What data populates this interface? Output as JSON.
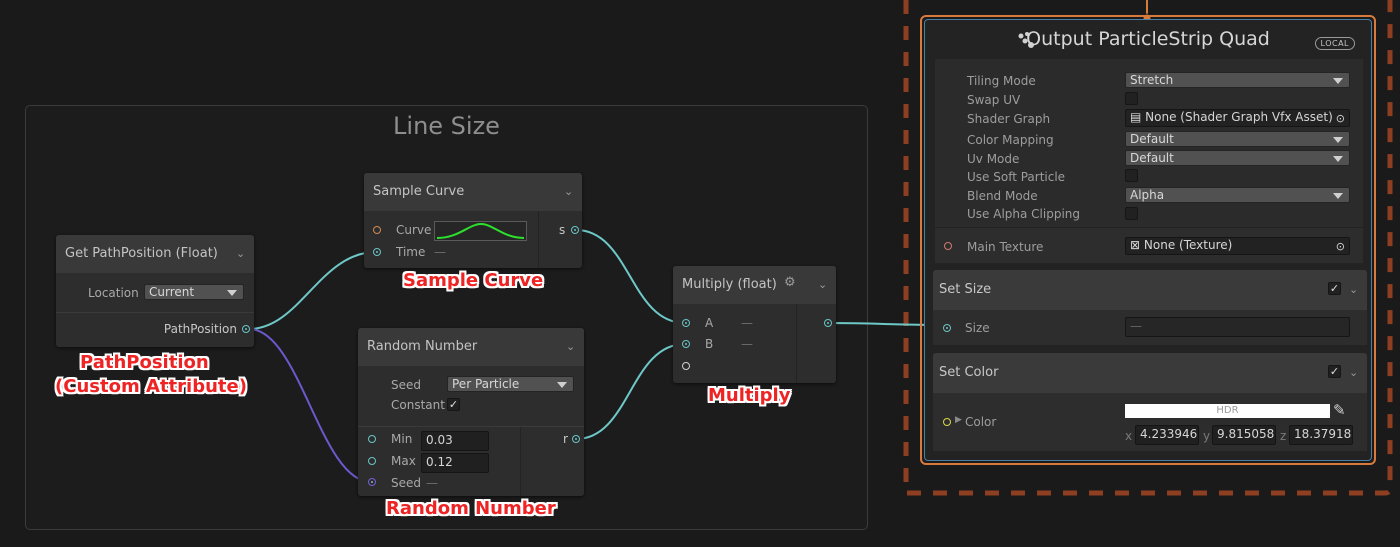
{
  "group": {
    "title": "Line Size"
  },
  "nodes": {
    "get_path": {
      "title": "Get PathPosition (Float)",
      "location_label": "Location",
      "location_value": "Current",
      "output_label": "PathPosition"
    },
    "sample_curve": {
      "title": "Sample Curve",
      "curve_label": "Curve",
      "time_label": "Time",
      "time_value": "—",
      "output_label": "s"
    },
    "random_number": {
      "title": "Random Number",
      "seed_label": "Seed",
      "seed_value": "Per Particle",
      "constant_label": "Constant",
      "constant_check": "✓",
      "min_label": "Min",
      "min_value": "0.03",
      "max_label": "Max",
      "max_value": "0.12",
      "seed_port_label": "Seed",
      "seed_port_value": "—",
      "output_label": "r"
    },
    "multiply": {
      "title": "Multiply (float)",
      "a_label": "A",
      "a_value": "—",
      "b_label": "B",
      "b_value": "—"
    }
  },
  "annotations": {
    "sample_curve": "Sample Curve",
    "path_position_1": "PathPosition",
    "path_position_2": "(Custom Attribute)",
    "random_number": "Random Number",
    "multiply": "Multiply"
  },
  "output_context": {
    "title": "Output ParticleStrip Quad",
    "badge": "LOCAL",
    "properties": [
      {
        "label": "Tiling Mode",
        "value": "Stretch",
        "kind": "dropdown"
      },
      {
        "label": "Swap UV",
        "value": "",
        "kind": "checkbox"
      },
      {
        "label": "Shader Graph",
        "value": "None (Shader Graph Vfx Asset)",
        "kind": "object"
      },
      {
        "label": "Color Mapping",
        "value": "Default",
        "kind": "dropdown"
      },
      {
        "label": "Uv Mode",
        "value": "Default",
        "kind": "dropdown"
      },
      {
        "label": "Use Soft Particle",
        "value": "",
        "kind": "checkbox"
      },
      {
        "label": "Blend Mode",
        "value": "Alpha",
        "kind": "dropdown"
      },
      {
        "label": "Use Alpha Clipping",
        "value": "",
        "kind": "checkbox"
      }
    ],
    "main_texture": {
      "label": "Main Texture",
      "value": "None (Texture)"
    },
    "set_size": {
      "title": "Set Size",
      "check": "✓",
      "size_label": "Size",
      "size_value": "—"
    },
    "set_color": {
      "title": "Set Color",
      "check": "✓",
      "color_label": "Color",
      "hdr_label": "HDR",
      "x_label": "x",
      "x_value": "4.233946",
      "y_label": "y",
      "y_value": "9.815058",
      "z_label": "z",
      "z_value": "18.37918"
    }
  },
  "colors": {
    "accent_orange": "#d97a3d",
    "wire_teal": "#6fc8c8",
    "wire_purple": "#6a5acd",
    "annotation_red": "#ee2424"
  }
}
